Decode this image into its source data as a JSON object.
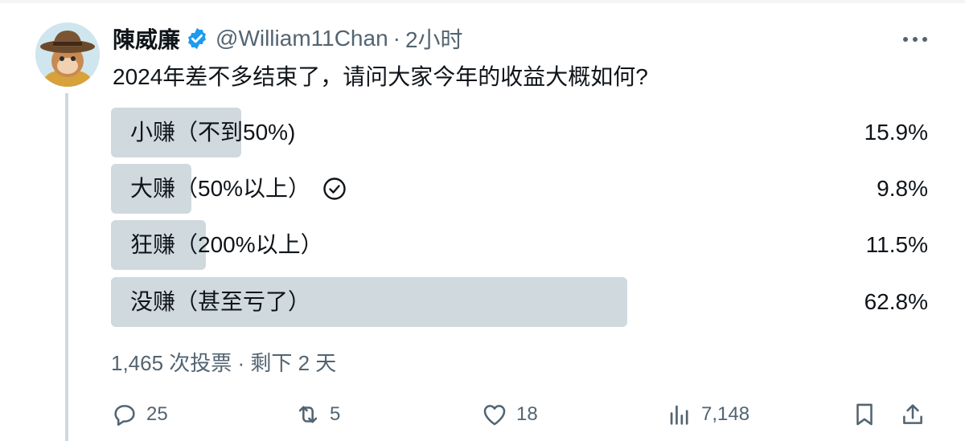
{
  "post": {
    "author_name": "陳威廉",
    "handle": "@William11Chan",
    "separator": "·",
    "time": "2小时",
    "text": "2024年差不多结束了，请问大家今年的收益大概如何?"
  },
  "poll": {
    "options": [
      {
        "label": "小赚（不到50%)",
        "percent_text": "15.9%",
        "fraction": 0.159,
        "voted": false
      },
      {
        "label": "大赚（50%以上）",
        "percent_text": "9.8%",
        "fraction": 0.098,
        "voted": true
      },
      {
        "label": "狂赚（200%以上）",
        "percent_text": "11.5%",
        "fraction": 0.115,
        "voted": false
      },
      {
        "label": "没赚（甚至亏了）",
        "percent_text": "62.8%",
        "fraction": 0.628,
        "voted": false
      }
    ],
    "meta": "1,465 次投票 · 剩下 2 天"
  },
  "actions": {
    "replies": "25",
    "reposts": "5",
    "likes": "18",
    "views": "7,148"
  },
  "colors": {
    "accent_blue": "#1d9bf0",
    "bar": "#cfd9de",
    "secondary_text": "#536471"
  },
  "icons": [
    "verified-badge-icon",
    "more-icon",
    "check-circle-icon",
    "reply-icon",
    "repost-icon",
    "like-icon",
    "views-icon",
    "bookmark-icon",
    "share-icon"
  ]
}
